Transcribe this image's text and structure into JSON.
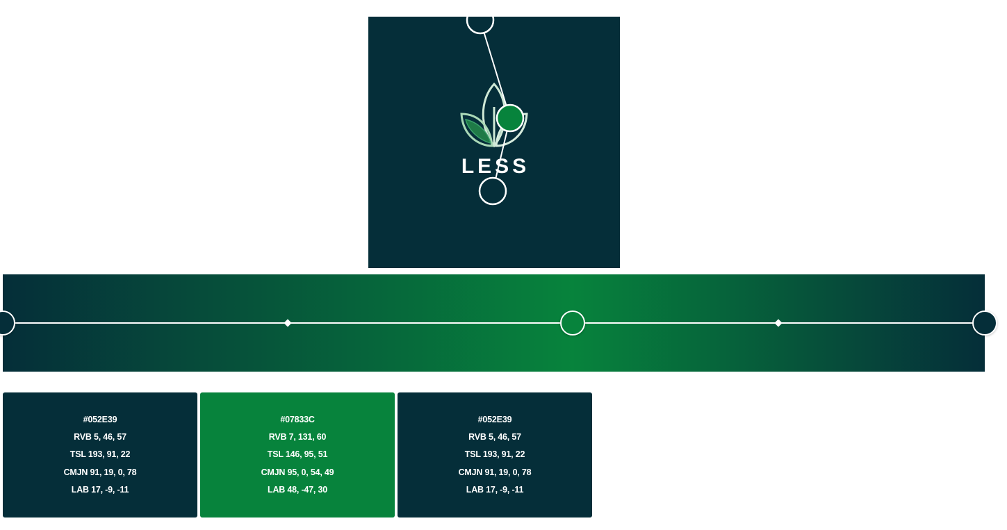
{
  "colors": {
    "dark_teal": "#052E39",
    "green": "#07833C",
    "white": "#ffffff"
  },
  "logo": {
    "text": "LESS",
    "icon": "leaf-sprout-icon"
  },
  "gradient": {
    "stops": [
      {
        "color": "#052E39",
        "position_pct": 0
      },
      {
        "color": "#07833C",
        "position_pct": 58
      },
      {
        "color": "#052E39",
        "position_pct": 100
      }
    ],
    "midpoints_pct": [
      29,
      79
    ]
  },
  "swatches": [
    {
      "hex": "#052E39",
      "rvb": "RVB 5, 46, 57",
      "tsl": "TSL 193, 91, 22",
      "cmjn": "CMJN 91, 19, 0, 78",
      "lab": "LAB 17, -9, -11"
    },
    {
      "hex": "#07833C",
      "rvb": "RVB 7, 131, 60",
      "tsl": "TSL 146, 95, 51",
      "cmjn": "CMJN 95, 0, 54, 49",
      "lab": "LAB 48, -47, 30"
    },
    {
      "hex": "#052E39",
      "rvb": "RVB 5, 46, 57",
      "tsl": "TSL 193, 91, 22",
      "cmjn": "CMJN 91, 19, 0, 78",
      "lab": "LAB 17, -9, -11"
    }
  ]
}
